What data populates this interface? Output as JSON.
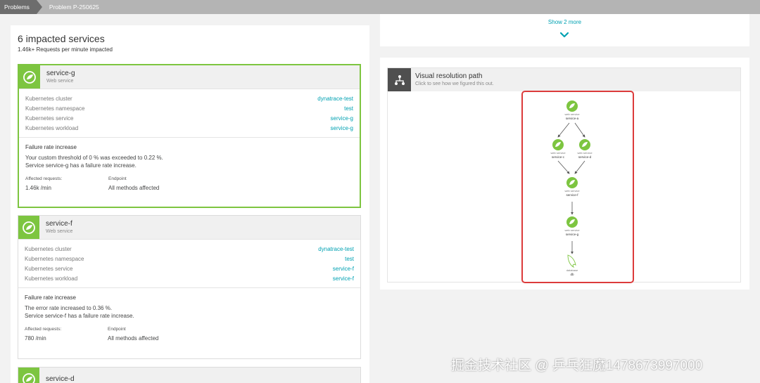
{
  "breadcrumb": {
    "root": "Problems",
    "current": "Problem P-250625"
  },
  "impacted": {
    "title": "6 impacted services",
    "subtitle": "1.46k+ Requests per minute impacted"
  },
  "services": [
    {
      "name": "service-g",
      "type": "Web service",
      "kv": [
        {
          "key": "Kubernetes cluster",
          "value": "dynatrace-test"
        },
        {
          "key": "Kubernetes namespace",
          "value": "test"
        },
        {
          "key": "Kubernetes service",
          "value": "service-g"
        },
        {
          "key": "Kubernetes workload",
          "value": "service-g"
        }
      ],
      "event_title": "Failure rate increase",
      "event_desc_1": "Your custom threshold of 0 % was exceeded to 0.22 %.",
      "event_desc_2": "Service service-g has a failure rate increase.",
      "affected_label": "Affected requests:",
      "affected_value": "1.46k /min",
      "endpoint_label": "Endpoint",
      "endpoint_value": "All methods affected"
    },
    {
      "name": "service-f",
      "type": "Web service",
      "kv": [
        {
          "key": "Kubernetes cluster",
          "value": "dynatrace-test"
        },
        {
          "key": "Kubernetes namespace",
          "value": "test"
        },
        {
          "key": "Kubernetes service",
          "value": "service-f"
        },
        {
          "key": "Kubernetes workload",
          "value": "service-f"
        }
      ],
      "event_title": "Failure rate increase",
      "event_desc_1": "The error rate increased to 0.36 %.",
      "event_desc_2": "Service service-f has a failure rate increase.",
      "affected_label": "Affected requests:",
      "affected_value": "780 /min",
      "endpoint_label": "Endpoint",
      "endpoint_value": "All methods affected"
    },
    {
      "name": "service-d"
    }
  ],
  "show_more": {
    "label": "Show 2 more"
  },
  "resolution": {
    "title": "Visual resolution path",
    "subtitle": "Click to see how we figured this out."
  },
  "graph": {
    "nodes": [
      {
        "type": "web service",
        "name": "service-a"
      },
      {
        "type": "web service",
        "name": "service-c"
      },
      {
        "type": "web service",
        "name": "service-d"
      },
      {
        "type": "web service",
        "name": "service-f"
      },
      {
        "type": "web service",
        "name": "service-g"
      },
      {
        "type": "database",
        "name": "db"
      }
    ]
  },
  "watermark": "掘金技术社区 @ 乒乓狂魔1478673997000",
  "colors": {
    "accent": "#00a1b2",
    "spring_green": "#7dc540",
    "highlight_red": "#dc3b3b"
  }
}
